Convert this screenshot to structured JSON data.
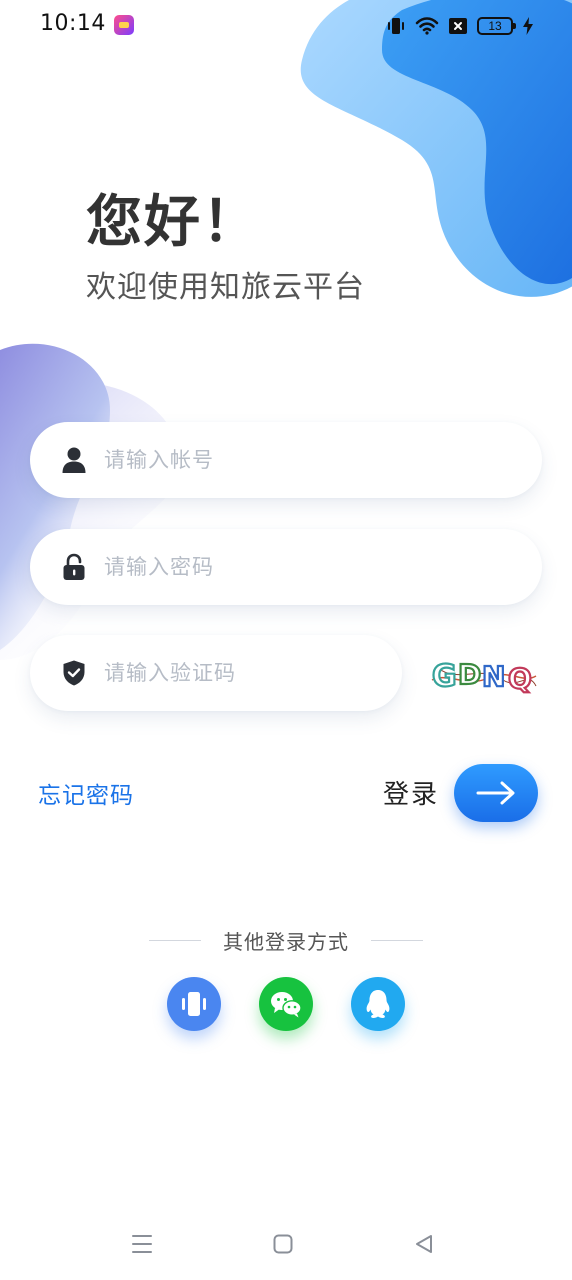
{
  "status_bar": {
    "time": "10:14",
    "battery": "13"
  },
  "greeting": {
    "title": "您好！",
    "subtitle": "欢迎使用知旅云平台"
  },
  "form": {
    "account_placeholder": "请输入帐号",
    "password_placeholder": "请输入密码",
    "captcha_placeholder": "请输入验证码",
    "captcha_text": "GDNQ"
  },
  "actions": {
    "forgot_password": "忘记密码",
    "login": "登录"
  },
  "other_login": {
    "label": "其他登录方式",
    "methods": [
      "phone-icon",
      "wechat-icon",
      "qq-icon"
    ]
  },
  "colors": {
    "primary": "#1a73e8",
    "phone": "#4a86f0",
    "wechat": "#17c23f",
    "qq": "#21a9f0"
  }
}
